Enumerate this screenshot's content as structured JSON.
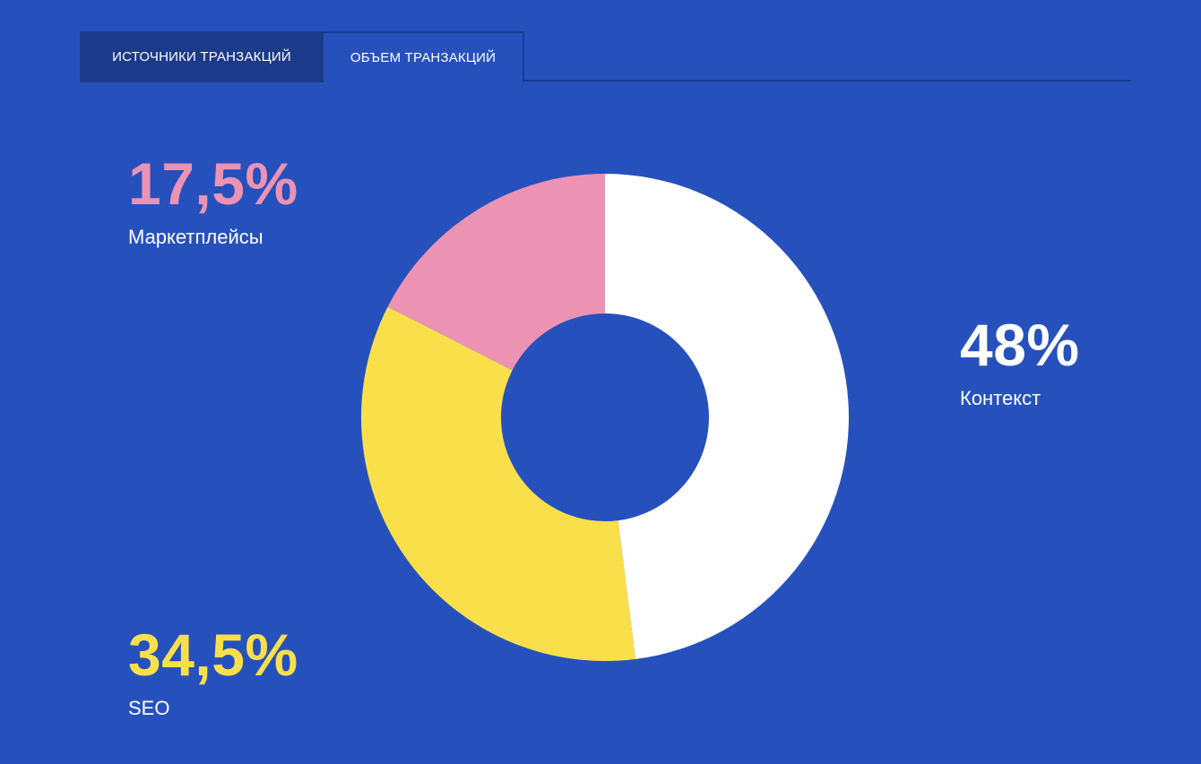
{
  "tabs": [
    {
      "label": "ИСТОЧНИКИ ТРАНЗАКЦИЙ",
      "active": false
    },
    {
      "label": "ОБЪЕМ ТРАНЗАКЦИЙ",
      "active": true
    }
  ],
  "colors": {
    "background": "#2651bd",
    "tab_dark": "#1c3a8a",
    "tab_border": "#1a3b8f",
    "context": "#ffffff",
    "seo": "#f9e04b",
    "marketplaces": "#ec93b3"
  },
  "chart_data": {
    "type": "pie",
    "donut": true,
    "start_angle_deg": 0,
    "direction": "clockwise",
    "slices": [
      {
        "name": "Контекст",
        "value": 48,
        "display": "48%",
        "color": "#ffffff"
      },
      {
        "name": "SEO",
        "value": 34.5,
        "display": "34,5%",
        "color": "#f9e04b"
      },
      {
        "name": "Маркетплейсы",
        "value": 17.5,
        "display": "17,5%",
        "color": "#ec93b3"
      }
    ]
  }
}
